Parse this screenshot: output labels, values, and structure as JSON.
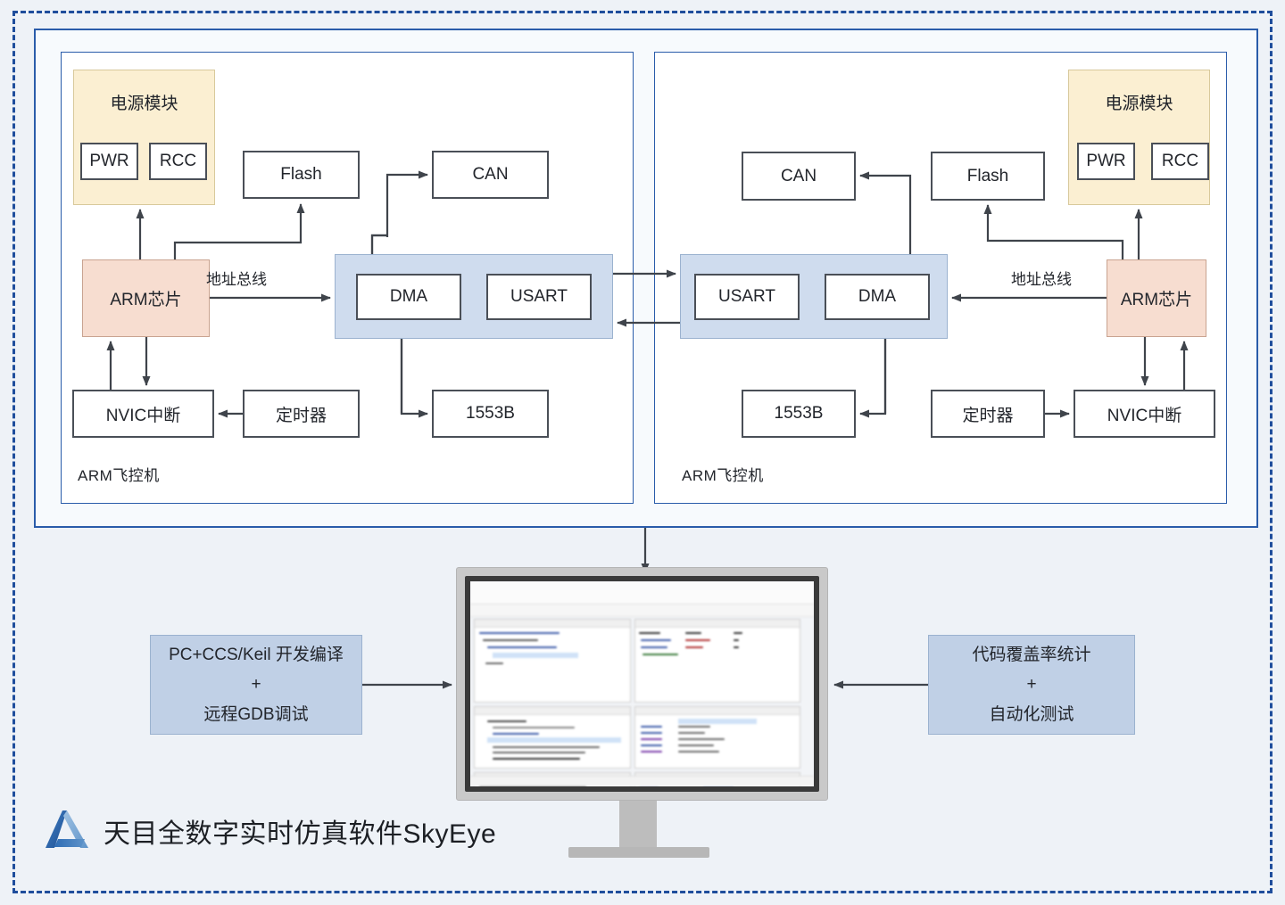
{
  "diagram": {
    "title_brand": "天目全数字实时仿真软件SkyEye",
    "logo_icon": "skyeye-triangle-logo",
    "panels": [
      {
        "caption": "ARM飞控机",
        "power_module": {
          "title": "电源模块",
          "children": [
            "PWR",
            "RCC"
          ]
        },
        "arm_chip": "ARM芯片",
        "bus_label": "地址总线",
        "peripherals": [
          "Flash",
          "CAN",
          "NVIC中断",
          "定时器",
          "1553B"
        ],
        "comm_group": [
          "DMA",
          "USART"
        ]
      },
      {
        "caption": "ARM飞控机",
        "power_module": {
          "title": "电源模块",
          "children": [
            "PWR",
            "RCC"
          ]
        },
        "arm_chip": "ARM芯片",
        "bus_label": "地址总线",
        "peripherals": [
          "CAN",
          "Flash",
          "NVIC中断",
          "定时器",
          "1553B"
        ],
        "comm_group": [
          "USART",
          "DMA"
        ]
      }
    ],
    "left_side_box": {
      "line1": "PC+CCS/Keil 开发编译",
      "line2": "+",
      "line3": "远程GDB调试"
    },
    "right_side_box": {
      "line1": "代码覆盖率统计",
      "line2": "+",
      "line3": "自动化测试"
    },
    "monitor": {
      "label": "skyeye-simulation-monitor"
    },
    "colors": {
      "frame_blue": "#1f4e9c",
      "panel_blue": "#2a5caa",
      "power_fill": "#fbefd2",
      "arm_fill": "#f7ddd0",
      "bus_fill": "#cfdcee",
      "side_fill": "#c0d0e6",
      "background": "#eef2f7",
      "wire": "#3f444b",
      "logo_blue": "#2f6db5"
    }
  }
}
